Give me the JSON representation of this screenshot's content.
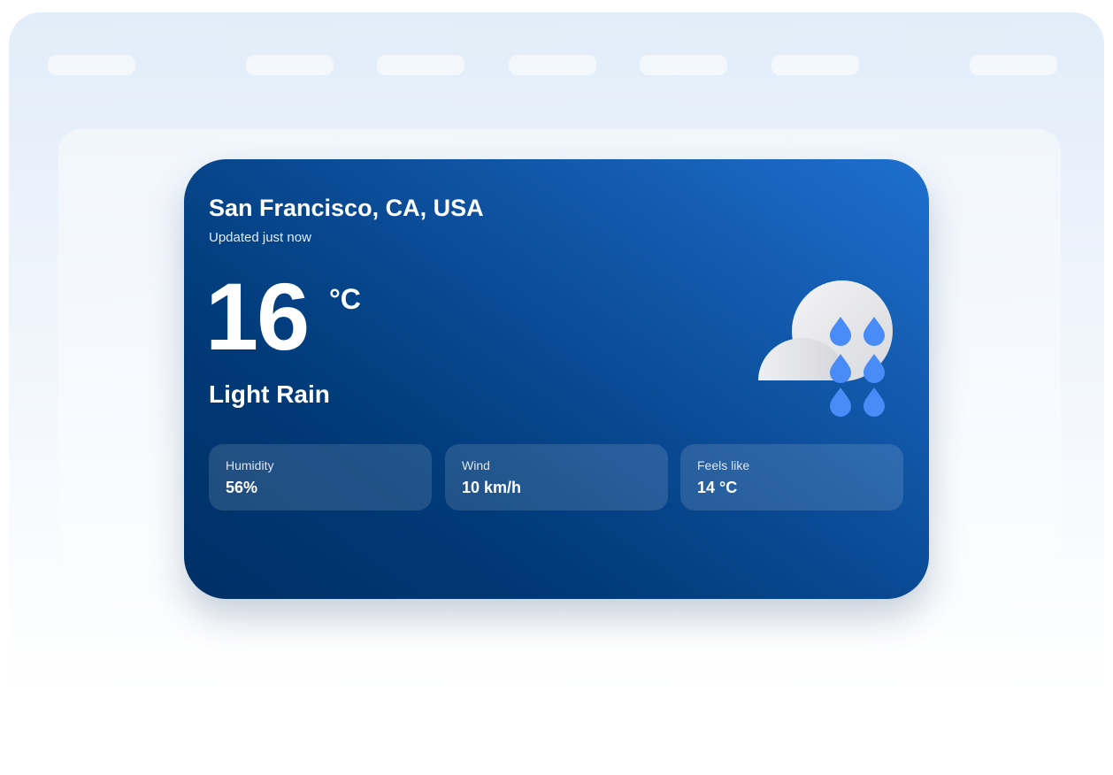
{
  "weather": {
    "location": "San Francisco, CA, USA",
    "updated": "Updated just now",
    "temperature": "16",
    "unit": "°C",
    "condition": "Light Rain",
    "icon": "cloud-rain-icon",
    "stats": [
      {
        "label": "Humidity",
        "value": "56%"
      },
      {
        "label": "Wind",
        "value": "10 km/h"
      },
      {
        "label": "Feels like",
        "value": "14 °C"
      }
    ]
  },
  "colors": {
    "card_dark": "#002f66",
    "card_light": "#1e6fcf",
    "rain_drop": "#4a8cf7"
  }
}
